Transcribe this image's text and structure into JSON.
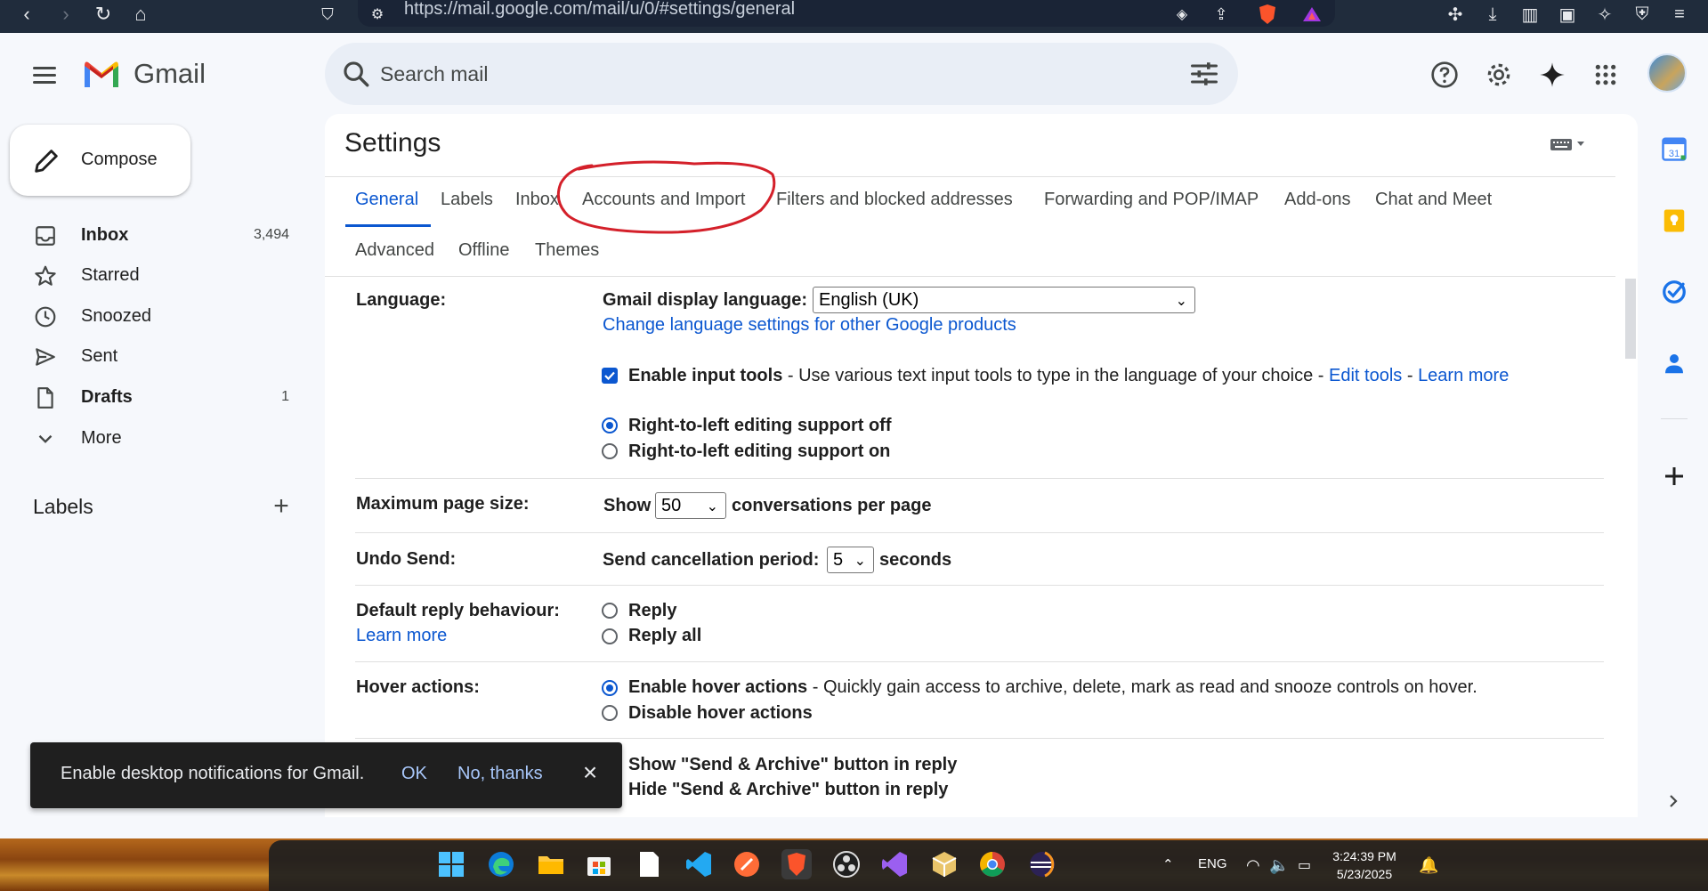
{
  "browser": {
    "url": "https://mail.google.com/mail/u/0/#settings/general"
  },
  "app": {
    "name": "Gmail",
    "search_placeholder": "Search mail"
  },
  "compose": {
    "label": "Compose"
  },
  "nav": {
    "items": [
      {
        "label": "Inbox",
        "count": "3,494",
        "bold": true,
        "icon": "inbox-icon"
      },
      {
        "label": "Starred",
        "count": "",
        "bold": false,
        "icon": "star-icon"
      },
      {
        "label": "Snoozed",
        "count": "",
        "bold": false,
        "icon": "clock-icon"
      },
      {
        "label": "Sent",
        "count": "",
        "bold": false,
        "icon": "send-icon"
      },
      {
        "label": "Drafts",
        "count": "1",
        "bold": true,
        "icon": "draft-icon"
      },
      {
        "label": "More",
        "count": "",
        "bold": false,
        "icon": "chevron-down-icon"
      }
    ],
    "labels_heading": "Labels"
  },
  "settings": {
    "title": "Settings",
    "tabs_row1": [
      "General",
      "Labels",
      "Inbox",
      "Accounts and Import",
      "Filters and blocked addresses",
      "Forwarding and POP/IMAP",
      "Add-ons",
      "Chat and Meet"
    ],
    "tabs_row2": [
      "Advanced",
      "Offline",
      "Themes"
    ],
    "active_tab": "General",
    "language": {
      "label": "Language:",
      "display_label": "Gmail display language:",
      "display_value": "English (UK)",
      "change_link": "Change language settings for other Google products",
      "input_tools_bold": "Enable input tools",
      "input_tools_desc": " - Use various text input tools to type in the language of your choice - ",
      "edit_tools": "Edit tools",
      "sep": " - ",
      "learn_more": "Learn more",
      "rtl_off": "Right-to-left editing support off",
      "rtl_on": "Right-to-left editing support on"
    },
    "page_size": {
      "label": "Maximum page size:",
      "show": "Show",
      "value": "50",
      "suffix": "conversations per page"
    },
    "undo_send": {
      "label": "Undo Send:",
      "period_label": "Send cancellation period:",
      "value": "5",
      "suffix": "seconds"
    },
    "reply": {
      "label": "Default reply behaviour:",
      "learn_more": "Learn more",
      "opt1": "Reply",
      "opt2": "Reply all"
    },
    "hover": {
      "label": "Hover actions:",
      "enable_bold": "Enable hover actions",
      "enable_desc": " - Quickly gain access to archive, delete, mark as read and snooze controls on hover.",
      "disable": "Disable hover actions"
    },
    "send_archive": {
      "show": "Show \"Send & Archive\" button in reply",
      "hide": "Hide \"Send & Archive\" button in reply"
    }
  },
  "toast": {
    "text": "Enable desktop notifications for Gmail.",
    "ok": "OK",
    "no": "No, thanks"
  },
  "taskbar": {
    "lang": "ENG",
    "time": "3:24:39 PM",
    "date": "5/23/2025"
  },
  "colors": {
    "accent": "#0b57d0",
    "annotation": "#d4202a",
    "gmail_red": "#ea4335"
  }
}
